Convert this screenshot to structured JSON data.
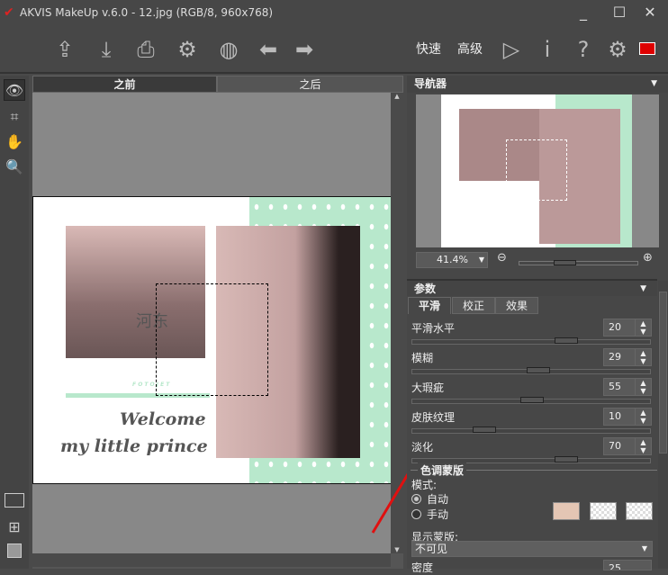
{
  "window": {
    "title": "AKVIS MakeUp v.6.0 - 12.jpg (RGB/8, 960x768)",
    "minimize": "_",
    "maximize": "☐",
    "close": "✕"
  },
  "toolbar": {
    "quick": "快速",
    "advanced": "高级"
  },
  "canvas": {
    "tab_before": "之前",
    "tab_after": "之后"
  },
  "image": {
    "watermark": "河东",
    "brand": "F O T O J E T",
    "line1": "Welcome",
    "line2": "my little prince"
  },
  "navigator": {
    "title": "导航器",
    "zoom": "41.4%",
    "zoom_fraction": 0.414
  },
  "params": {
    "title": "参数",
    "tabs": [
      "平滑",
      "校正",
      "效果"
    ],
    "rows": [
      {
        "label": "平滑水平",
        "value": "20"
      },
      {
        "label": "模糊",
        "value": "29"
      },
      {
        "label": "大瑕疵",
        "value": "55"
      },
      {
        "label": "皮肤纹理",
        "value": "10"
      },
      {
        "label": "淡化",
        "value": "70"
      }
    ],
    "tone_mask": {
      "title": "色调蒙版",
      "mode_label": "模式:",
      "auto": "自动",
      "manual": "手动",
      "swatch_color": "#e4c6b4",
      "show_mask_label": "显示蒙版:",
      "show_mask_value": "不可见",
      "density_label": "密度",
      "density_value": "25"
    }
  },
  "colors": {
    "accent_red": "#e01010",
    "mint": "#b8e8cc"
  }
}
